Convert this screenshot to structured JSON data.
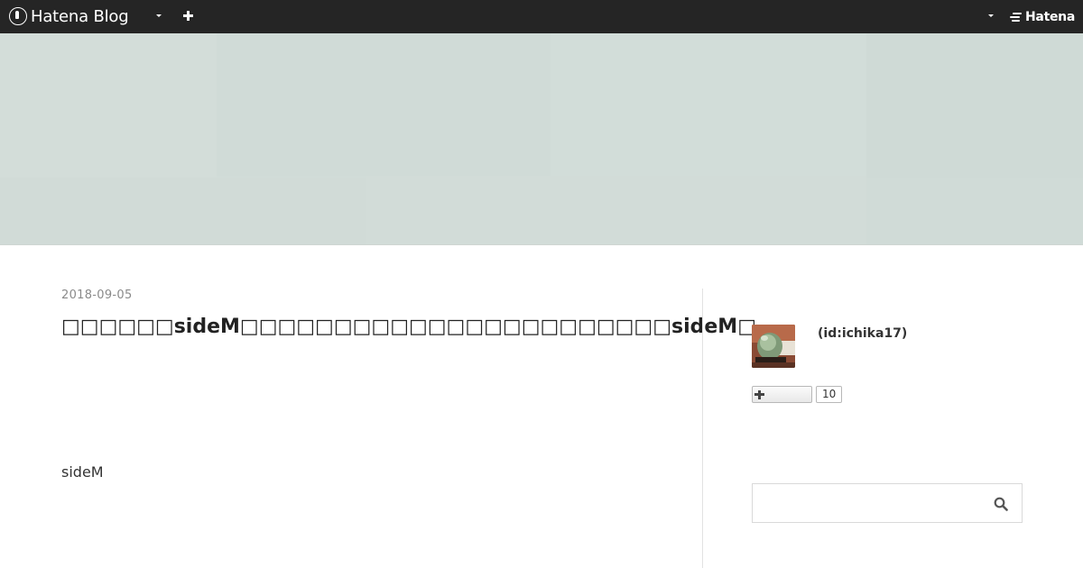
{
  "topbar": {
    "logo_text": "Hatena Blog",
    "hatena_text": "Hatena"
  },
  "entry": {
    "date": "2018-09-05",
    "title": "□□□□□□sideM□□□□□□□□□□□□□□□□□□□□□□□sideM□",
    "body": "sideM"
  },
  "profile": {
    "id": "(id:ichika17)",
    "follow_count": "10"
  },
  "search": {
    "placeholder": "",
    "value": ""
  },
  "icons": {
    "logo": "hatena-blog-logo-icon",
    "menu_caret": "caret-down-icon",
    "add": "plus-icon",
    "follow": "plus-icon",
    "search": "magnifier-icon"
  }
}
